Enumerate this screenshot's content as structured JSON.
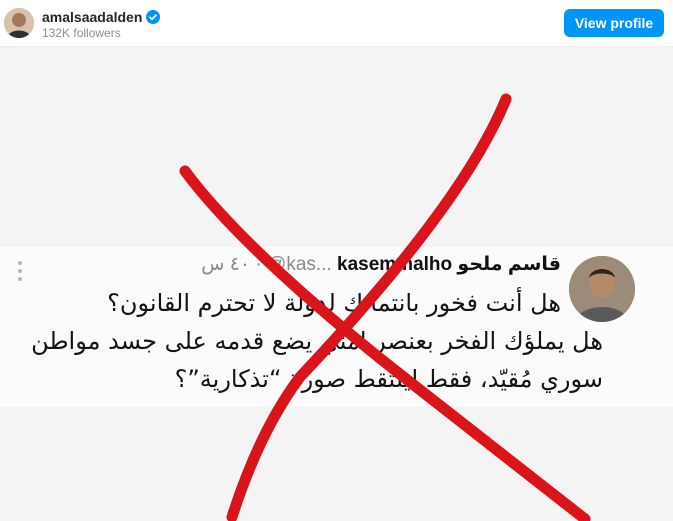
{
  "header": {
    "username": "amalsaadalden",
    "followers": "132K followers",
    "view_profile_label": "View profile"
  },
  "tweet": {
    "name_ar": "قاسم ملحو",
    "name_en": "kasemmalho",
    "handle": "@kas...",
    "time": "٤٠ س",
    "lines": [
      "هل أنت فخور بانتمائك لدولة لا تحترم القانون؟",
      "هل يملؤك الفخر بعنصر امني يضع قدمه على جسد مواطن",
      "سوري مُقيّد، فقط ليلتقط صورة “تذكارية”؟"
    ]
  },
  "icons": {
    "verified": "verified-badge-icon",
    "more": "more-vertical-icon"
  },
  "colors": {
    "accent": "#0095f6",
    "cross": "#d9151b",
    "verified": "#0095f6"
  }
}
